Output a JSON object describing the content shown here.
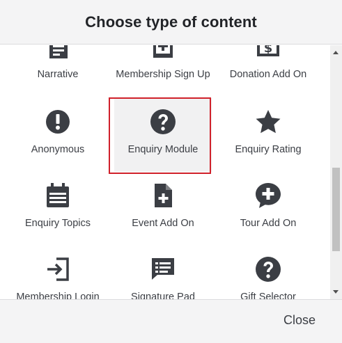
{
  "dialog": {
    "title": "Choose type of content",
    "close_label": "Close"
  },
  "tiles": [
    {
      "label": "Narrative",
      "icon": "document-icon"
    },
    {
      "label": "Membership Sign Up",
      "icon": "add-box-icon"
    },
    {
      "label": "Donation Add On",
      "icon": "dollar-icon"
    },
    {
      "label": "Anonymous",
      "icon": "exclamation-circle-icon"
    },
    {
      "label": "Enquiry Module",
      "icon": "question-circle-icon",
      "selected": true
    },
    {
      "label": "Enquiry Rating",
      "icon": "star-icon"
    },
    {
      "label": "Enquiry Topics",
      "icon": "calendar-list-icon"
    },
    {
      "label": "Event Add On",
      "icon": "file-plus-icon"
    },
    {
      "label": "Tour Add On",
      "icon": "chat-plus-icon"
    },
    {
      "label": "Membership Login",
      "icon": "login-icon"
    },
    {
      "label": "Signature Pad",
      "icon": "message-lines-icon"
    },
    {
      "label": "Gift Selector",
      "icon": "question-circle-icon"
    }
  ],
  "colors": {
    "icon": "#3b3e44",
    "selection_border": "#d0202a",
    "selected_bg": "#f1f1f2",
    "header_bg": "#f4f4f5"
  }
}
